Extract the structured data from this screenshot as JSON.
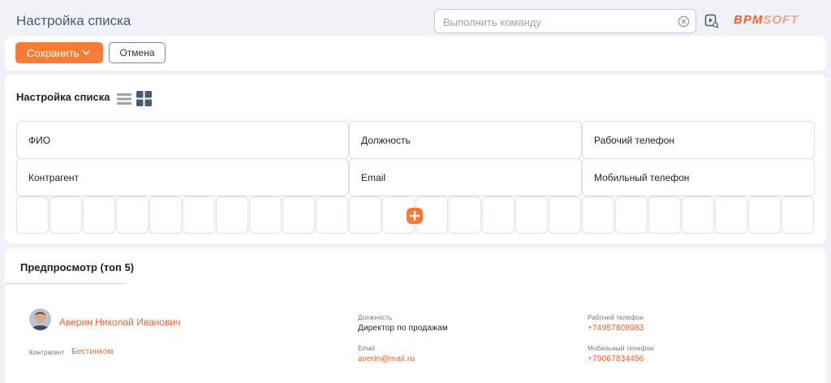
{
  "header": {
    "title": "Настройка списка",
    "command_placeholder": "Выполнить команду",
    "logo_part1": "BPM",
    "logo_part2": "SOFT"
  },
  "toolbar": {
    "save_label": "Сохранить",
    "cancel_label": "Отмена"
  },
  "list_settings": {
    "title": "Настройка списка",
    "rows": [
      [
        "ФИО",
        "Должность",
        "Рабочий телефон"
      ],
      [
        "Контрагент",
        "Email",
        "Мобильный телефон"
      ]
    ]
  },
  "preview": {
    "title": "Предпросмотр (топ 5)",
    "contact_name": "Аверин Николай Иванович",
    "account_label": "Контрагент",
    "account_value": "Бестинком",
    "job_label": "Должность",
    "job_value": "Директор по продажам",
    "email_label": "Email",
    "email_value": "averin@mail.ru",
    "work_phone_label": "Рабочий телефон",
    "work_phone_value": "+74957808083",
    "mobile_phone_label": "Мобильный телефон",
    "mobile_phone_value": "+79067834456"
  },
  "colors": {
    "accent": "#f77d37",
    "link": "#f4612a",
    "background": "#f0f2f7"
  },
  "icons": [
    "clear-icon",
    "play-search-icon",
    "chevron-down-icon",
    "list-view-icon",
    "grid-view-icon",
    "plus-icon"
  ]
}
